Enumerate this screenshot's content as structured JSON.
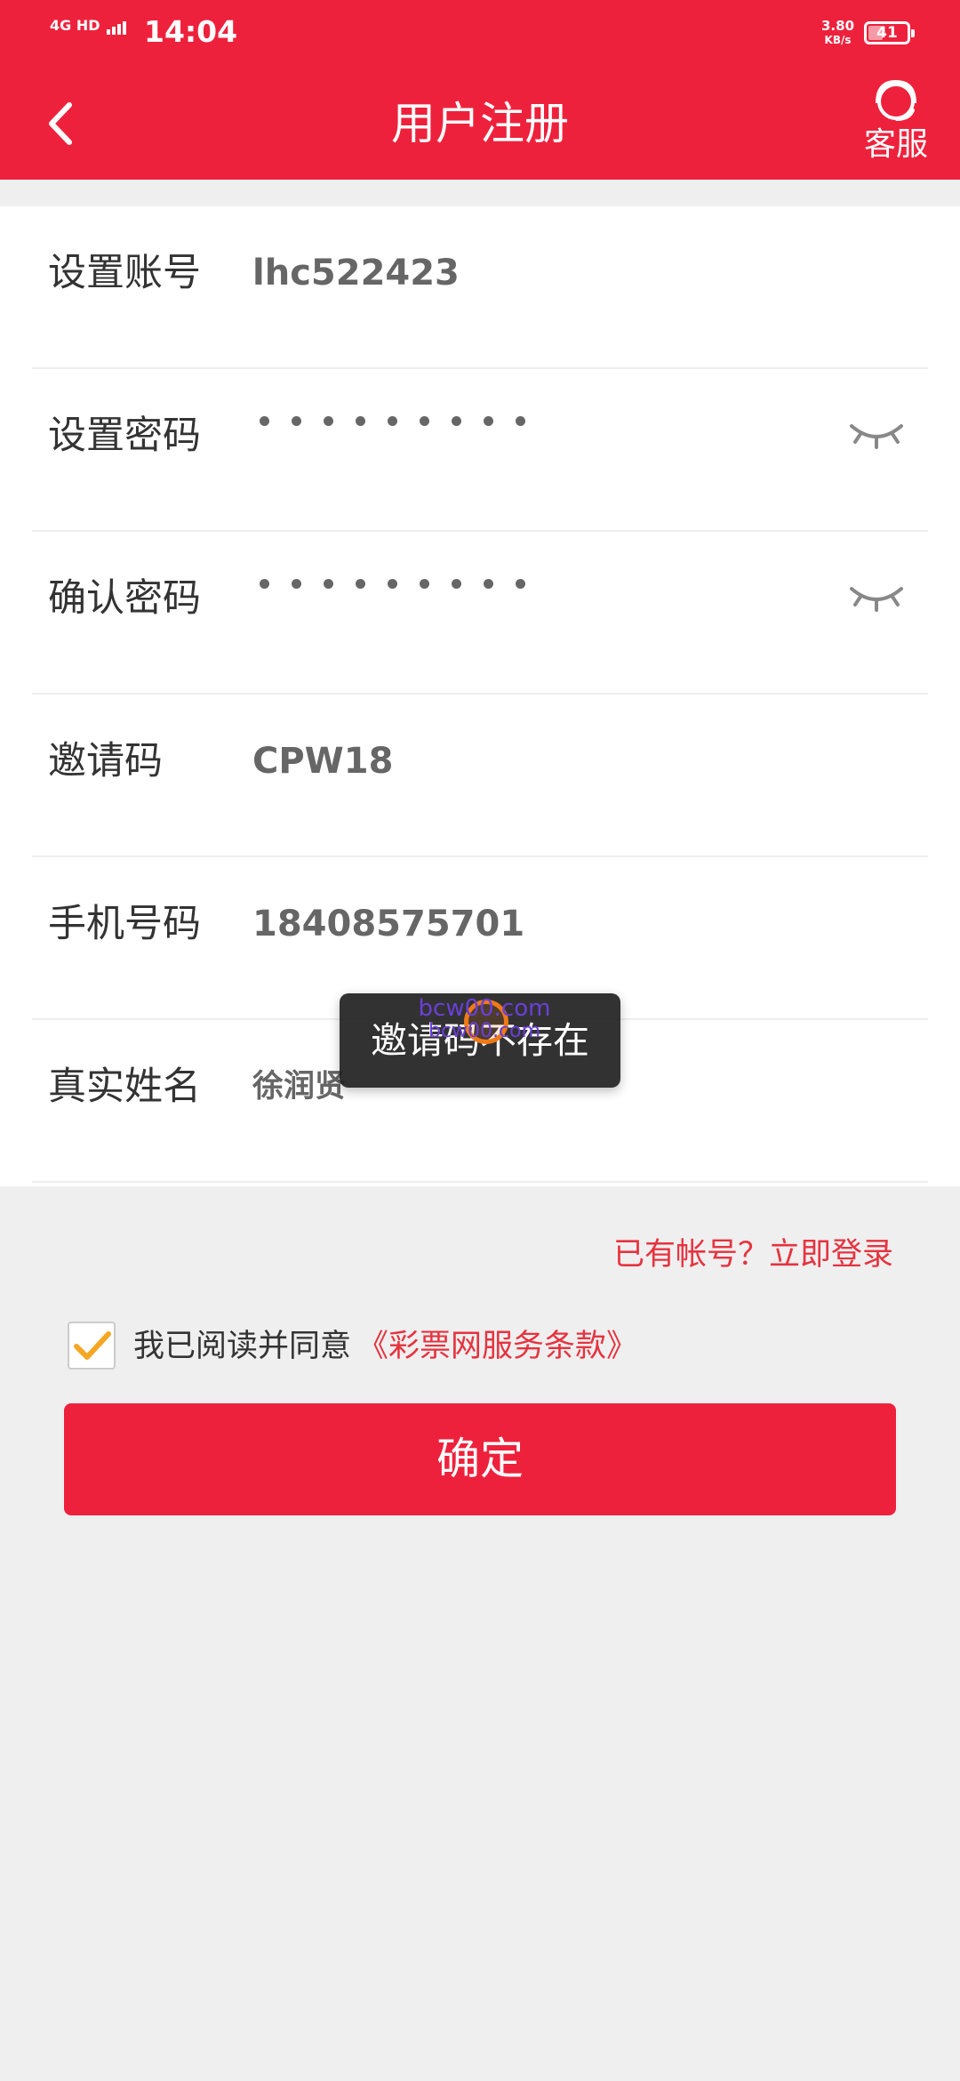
{
  "status_bar": {
    "signal1": "4G HD",
    "signal2": "4G HD",
    "time": "14:04",
    "speed_value": "3.80",
    "speed_unit": "KB/s",
    "battery": "41"
  },
  "header": {
    "title": "用户注册",
    "service_label": "客服"
  },
  "form": {
    "account": {
      "label": "设置账号",
      "value": "lhc522423"
    },
    "password": {
      "label": "设置密码"
    },
    "confirm_password": {
      "label": "确认密码"
    },
    "invite_code": {
      "label": "邀请码",
      "value": "CPW18"
    },
    "phone": {
      "label": "手机号码",
      "value": "18408575701"
    },
    "real_name": {
      "label": "真实姓名",
      "value": "徐润贤"
    }
  },
  "login_link": "已有帐号？立即登录",
  "agreement": {
    "text": "我已阅读并同意",
    "terms": "《彩票网服务条款》",
    "checked": true
  },
  "confirm_button": "确定",
  "toast": "邀请码不存在",
  "watermark": {
    "line1": "bcw00.com",
    "line2": "bcw00.com"
  },
  "colors": {
    "brand": "#ee213c",
    "link": "#e6333f",
    "check": "#f5a623"
  }
}
